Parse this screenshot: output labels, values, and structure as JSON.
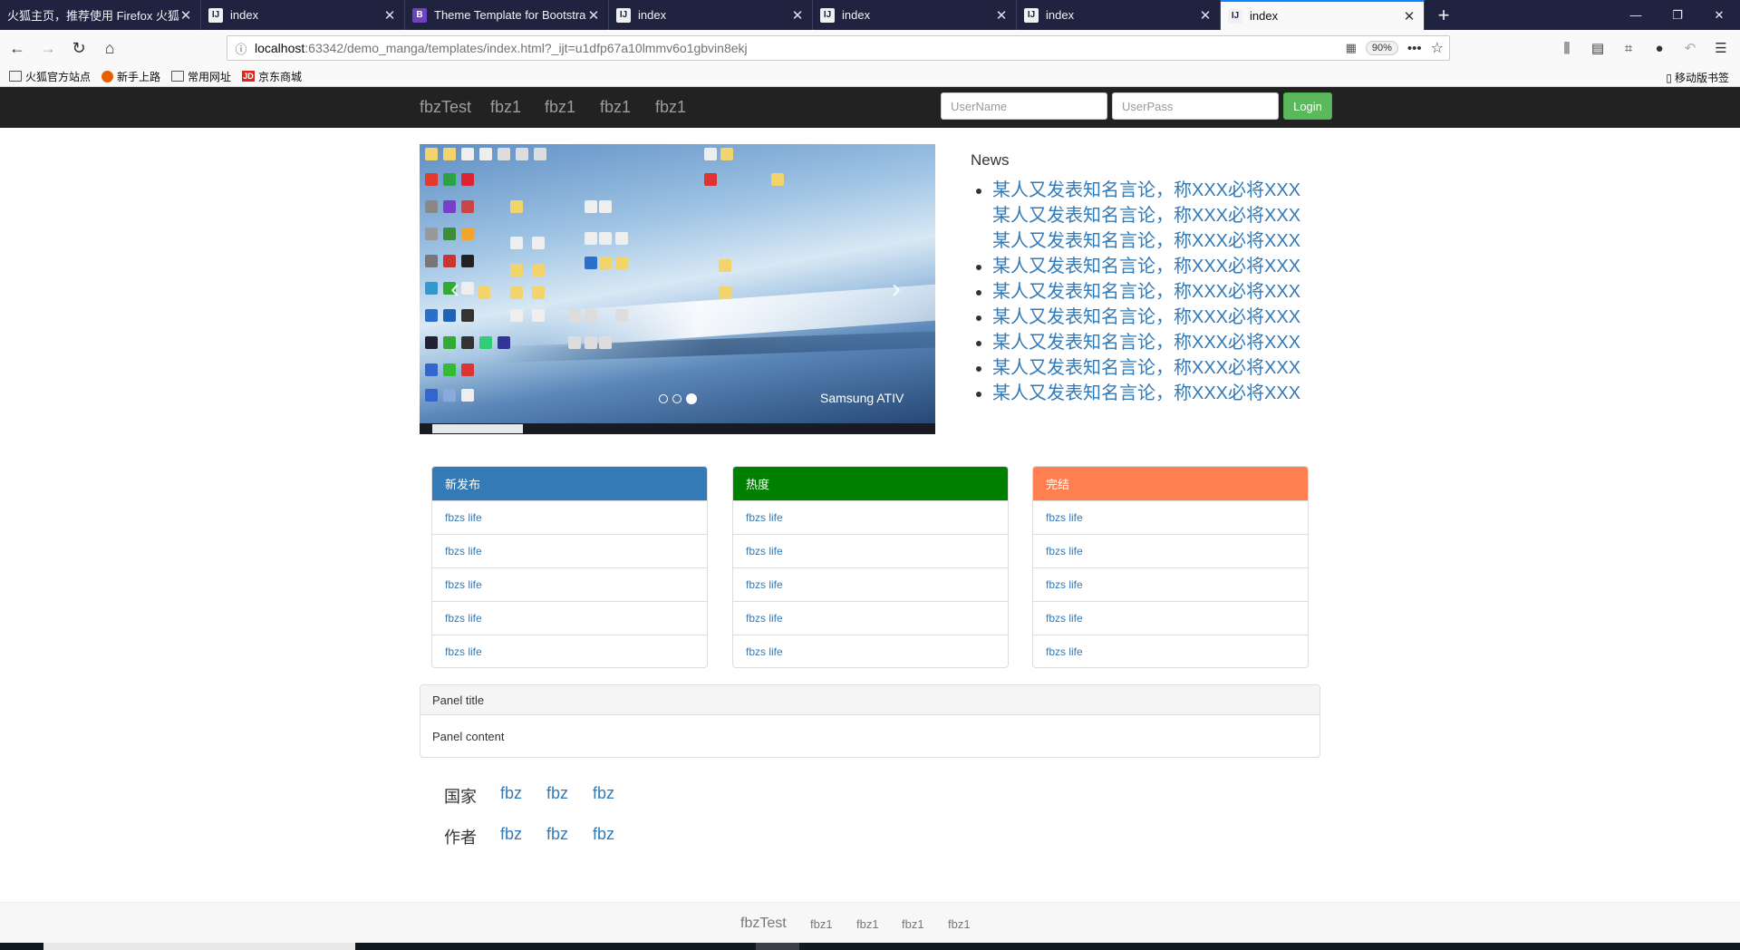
{
  "browser": {
    "tabs": [
      {
        "title": "火狐主页，推荐使用 Firefox 火狐浏览器",
        "icon": "firefox-icon"
      },
      {
        "title": "index",
        "icon": "intellij-icon"
      },
      {
        "title": "Theme Template for Bootstrap",
        "icon": "bootstrap-icon"
      },
      {
        "title": "index",
        "icon": "intellij-icon"
      },
      {
        "title": "index",
        "icon": "intellij-icon"
      },
      {
        "title": "index",
        "icon": "intellij-icon"
      },
      {
        "title": "index",
        "icon": "intellij-icon",
        "active": true
      }
    ],
    "url_host": "localhost",
    "url_path": ":63342/demo_manga/templates/index.html?_ijt=u1dfp67a10lmmv6o1gbvin8ekj",
    "zoom": "90%",
    "bookmarks": [
      {
        "label": "火狐官方站点",
        "icon": "folder-icon"
      },
      {
        "label": "新手上路",
        "icon": "firefox-icon"
      },
      {
        "label": "常用网址",
        "icon": "folder-icon"
      },
      {
        "label": "京东商城",
        "icon": "jd-icon"
      }
    ],
    "mobile_bookmarks": "移动版书签"
  },
  "nav": {
    "brand": "fbzTest",
    "links": [
      "fbz1",
      "fbz1",
      "fbz1",
      "fbz1"
    ],
    "username_placeholder": "UserName",
    "password_placeholder": "UserPass",
    "login_label": "Login"
  },
  "carousel": {
    "watermark": "Samsung ATIV",
    "slide_count": 3,
    "active_slide": 3
  },
  "news": {
    "heading": "News",
    "items": [
      "某人又发表知名言论，称XXX必将XXX某人又发表知名言论，称XXX必将XXX某人又发表知名言论，称XXX必将XXX",
      "某人又发表知名言论，称XXX必将XXX",
      "某人又发表知名言论，称XXX必将XXX",
      "某人又发表知名言论，称XXX必将XXX",
      "某人又发表知名言论，称XXX必将XXX",
      "某人又发表知名言论，称XXX必将XXX",
      "某人又发表知名言论，称XXX必将XXX"
    ]
  },
  "panels": [
    {
      "title": "新发布",
      "color": "#337ab7",
      "items": [
        "fbzs life",
        "fbzs life",
        "fbzs life",
        "fbzs life",
        "fbzs life"
      ]
    },
    {
      "title": "热度",
      "color": "#008000",
      "items": [
        "fbzs life",
        "fbzs life",
        "fbzs life",
        "fbzs life",
        "fbzs life"
      ]
    },
    {
      "title": "完结",
      "color": "#ff7f50",
      "items": [
        "fbzs life",
        "fbzs life",
        "fbzs life",
        "fbzs life",
        "fbzs life"
      ]
    }
  ],
  "wide_panel": {
    "title": "Panel title",
    "content": "Panel content"
  },
  "tags": [
    {
      "label": "国家",
      "links": [
        "fbz",
        "fbz",
        "fbz"
      ]
    },
    {
      "label": "作者",
      "links": [
        "fbz",
        "fbz",
        "fbz"
      ]
    }
  ],
  "footer": {
    "brand": "fbzTest",
    "links": [
      "fbz1",
      "fbz1",
      "fbz1",
      "fbz1"
    ]
  }
}
